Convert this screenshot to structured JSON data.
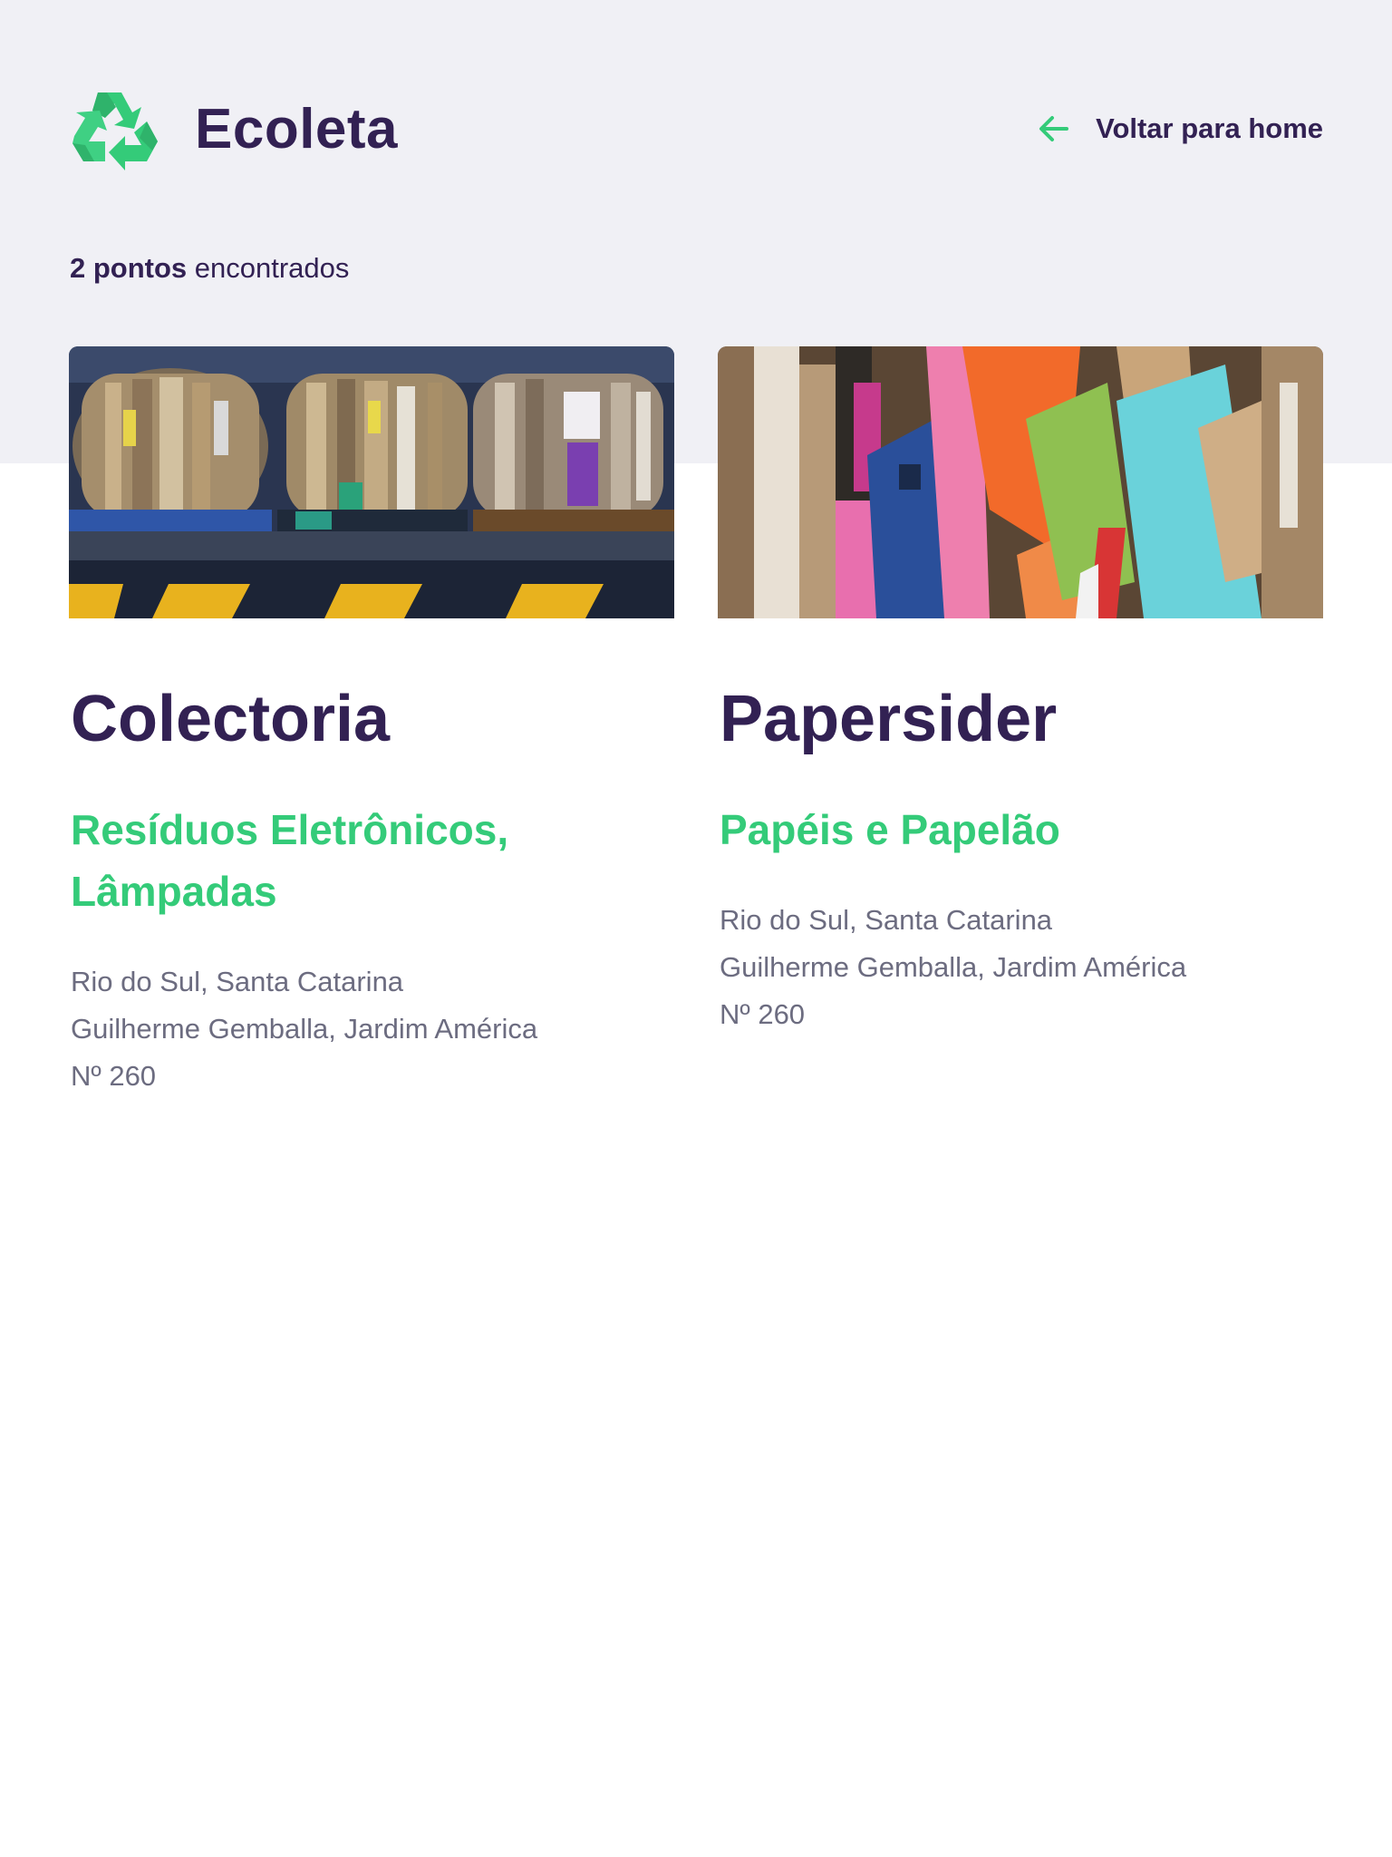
{
  "header": {
    "brand_name": "Ecoleta",
    "logo_icon": "recycle-icon",
    "back_label": "Voltar para home",
    "back_icon": "arrow-left-icon",
    "accent_color": "#34cb79",
    "title_color": "#322153"
  },
  "results": {
    "count_bold": "2 pontos",
    "count_rest": " encontrados"
  },
  "points": [
    {
      "name": "Colectoria",
      "items": "Resíduos Eletrônicos, Lâmpadas",
      "city_state": "Rio do Sul, Santa Catarina",
      "street_district": "Guilherme Gemballa, Jardim América",
      "number": "Nº 260"
    },
    {
      "name": "Papersider",
      "items": "Papéis e Papelão",
      "city_state": "Rio do Sul, Santa Catarina",
      "street_district": "Guilherme Gemballa, Jardim América",
      "number": "Nº 260"
    }
  ]
}
